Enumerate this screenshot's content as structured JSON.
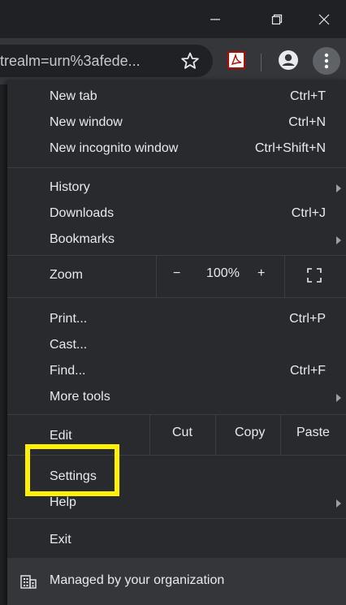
{
  "window": {
    "minimize_icon": "minimize-icon",
    "restore_icon": "restore-icon",
    "close_icon": "close-icon"
  },
  "toolbar": {
    "url_text": "trealm=urn%3afede...",
    "star_icon": "star-icon",
    "extension_icon": "pdf-extension-icon",
    "profile_icon": "profile-icon",
    "menu_icon": "more-vert-icon"
  },
  "menu": {
    "new_tab": {
      "label": "New tab",
      "accel": "Ctrl+T"
    },
    "new_window": {
      "label": "New window",
      "accel": "Ctrl+N"
    },
    "new_incognito": {
      "label": "New incognito window",
      "accel": "Ctrl+Shift+N"
    },
    "history": {
      "label": "History"
    },
    "downloads": {
      "label": "Downloads",
      "accel": "Ctrl+J"
    },
    "bookmarks": {
      "label": "Bookmarks"
    },
    "zoom": {
      "label": "Zoom",
      "minus": "−",
      "level": "100%",
      "plus": "+",
      "fullscreen_icon": "fullscreen-icon"
    },
    "print": {
      "label": "Print...",
      "accel": "Ctrl+P"
    },
    "cast": {
      "label": "Cast..."
    },
    "find": {
      "label": "Find...",
      "accel": "Ctrl+F"
    },
    "more_tools": {
      "label": "More tools"
    },
    "edit": {
      "label": "Edit",
      "cut": "Cut",
      "copy": "Copy",
      "paste": "Paste"
    },
    "settings": {
      "label": "Settings"
    },
    "help": {
      "label": "Help"
    },
    "exit": {
      "label": "Exit"
    },
    "managed": {
      "label": "Managed by your organization",
      "icon": "building-icon"
    }
  },
  "colors": {
    "menu_bg": "#292a2d",
    "highlight": "#fff200"
  }
}
